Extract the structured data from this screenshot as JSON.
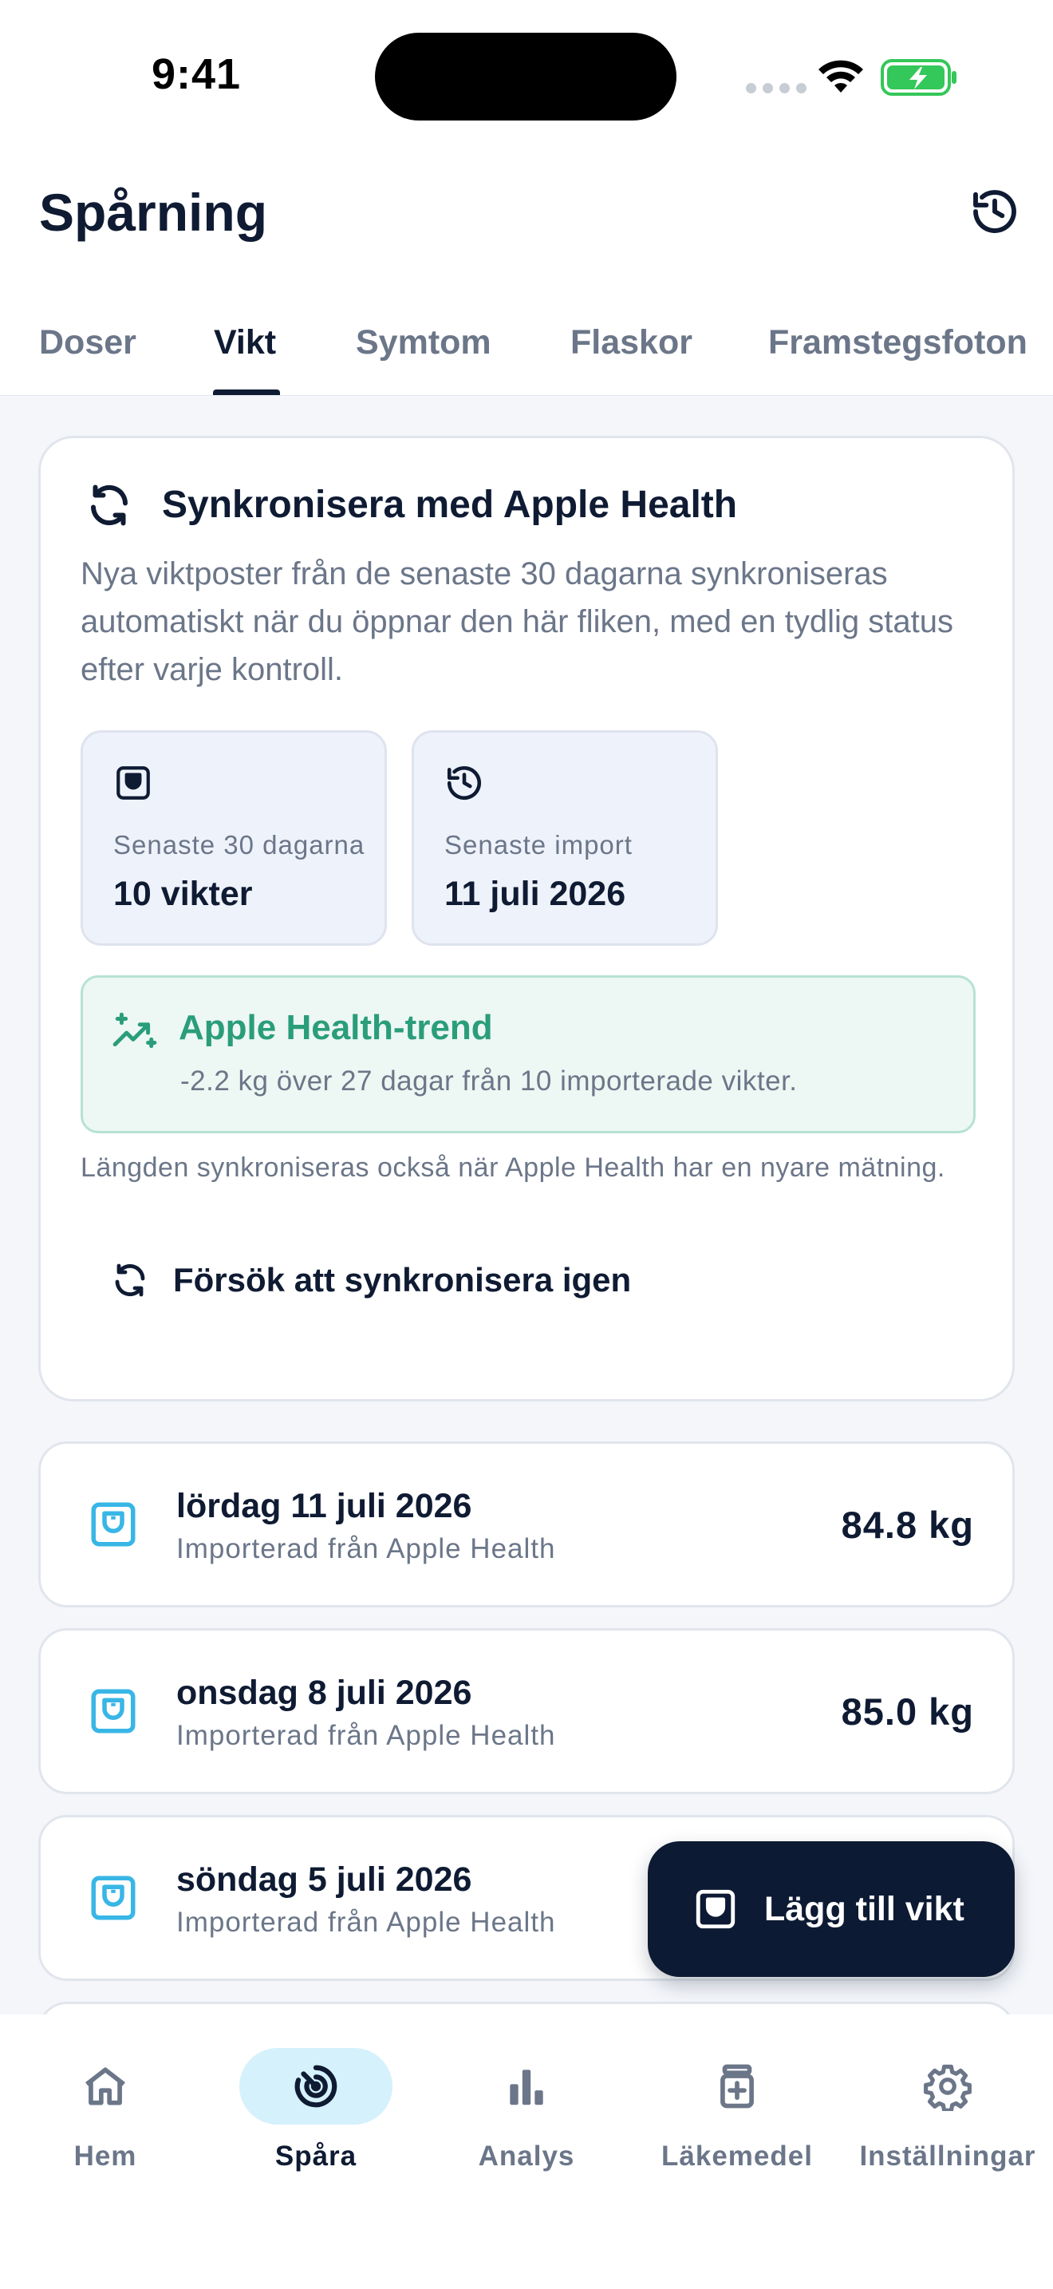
{
  "status_bar": {
    "time": "9:41"
  },
  "header": {
    "title": "Spårning",
    "history_icon": "history-icon",
    "tabs": [
      {
        "label": "Doser",
        "active": false
      },
      {
        "label": "Vikt",
        "active": true
      },
      {
        "label": "Symtom",
        "active": false
      },
      {
        "label": "Flaskor",
        "active": false
      },
      {
        "label": "Framstegsfoton",
        "active": false
      }
    ]
  },
  "sync_card": {
    "icon": "sync-icon",
    "title": "Synkronisera med Apple Health",
    "description": "Nya viktposter från de senaste 30 dagarna synkroniseras automatiskt när du öppnar den här fliken, med en tydlig status efter varje kontroll.",
    "stats": [
      {
        "icon": "scale-icon",
        "label": "Senaste 30 dagarna",
        "value": "10 vikter"
      },
      {
        "icon": "history-icon",
        "label": "Senaste import",
        "value": "11 juli 2026"
      }
    ],
    "trend": {
      "icon": "trend-sparkle-icon",
      "title": "Apple Health-trend",
      "text": "-2.2 kg över 27 dagar från 10 importerade vikter."
    },
    "length_note": "Längden synkroniseras också när Apple Health har en nyare mätning.",
    "retry_label": "Försök att synkronisera igen"
  },
  "weights": [
    {
      "date": "lördag 11 juli 2026",
      "source": "Importerad från Apple Health",
      "value": "84.8 kg"
    },
    {
      "date": "onsdag 8 juli 2026",
      "source": "Importerad från Apple Health",
      "value": "85.0 kg"
    },
    {
      "date": "söndag 5 juli 2026",
      "source": "Importerad från Apple Health",
      "value": ""
    }
  ],
  "fab": {
    "label": "Lägg till vikt",
    "icon": "scale-icon"
  },
  "bottom_nav": [
    {
      "label": "Hem",
      "icon": "home-icon",
      "active": false
    },
    {
      "label": "Spåra",
      "icon": "track-icon",
      "active": true
    },
    {
      "label": "Analys",
      "icon": "bar-chart-icon",
      "active": false
    },
    {
      "label": "Läkemedel",
      "icon": "medication-icon",
      "active": false
    },
    {
      "label": "Inställningar",
      "icon": "gear-icon",
      "active": false
    }
  ],
  "colors": {
    "primary_dark": "#0d1a33",
    "muted_text": "#6b7689",
    "accent_green": "#2a9d7a",
    "accent_blue": "#38b6e6",
    "nav_active_bg": "#d5f1fb",
    "background": "#f4f6fa"
  }
}
